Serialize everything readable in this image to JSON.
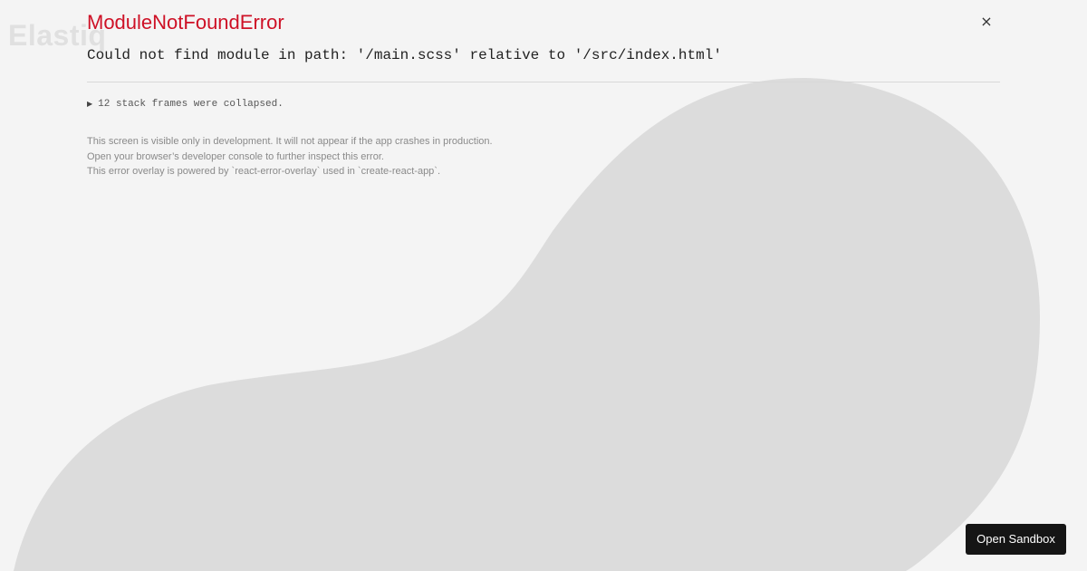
{
  "background": {
    "logo_text": "Elastiq",
    "color": "#f4f4f4",
    "blob_color": "#dcdcdc"
  },
  "error": {
    "title": "ModuleNotFoundError",
    "title_color": "#ce1126",
    "message": "Could not find module in path: '/main.scss' relative to '/src/index.html'",
    "close_icon": "close-icon",
    "close_glyph": "×",
    "stack": {
      "toggle_icon": "triangle-right-icon",
      "toggle_glyph": "▶",
      "label": "12 stack frames were collapsed."
    },
    "notes": [
      "This screen is visible only in development. It will not appear if the app crashes in production.",
      "Open your browser’s developer console to further inspect this error.",
      "This error overlay is powered by `react-error-overlay` used in `create-react-app`."
    ]
  },
  "sandbox_button": {
    "label": "Open Sandbox"
  }
}
